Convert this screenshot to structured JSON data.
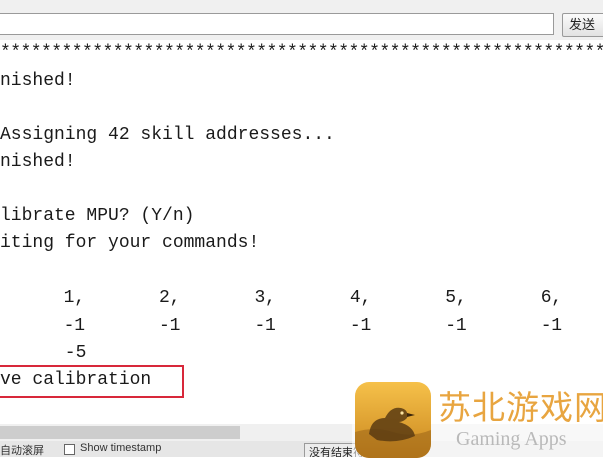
{
  "toolbar": {
    "send_label": "发送",
    "input_value": ""
  },
  "console": {
    "lines": [
      "************************************************************",
      "nished!",
      "",
      "Assigning 42 skill addresses...",
      "nished!",
      "",
      "librate MPU? (Y/n)",
      "iting for your commands!",
      "",
      "      1,       2,       3,       4,       5,       6,",
      "      -1       -1       -1       -1       -1       -1",
      "      -5",
      "ve calibration"
    ]
  },
  "statusbar": {
    "autoscroll_label": "自动滚屏",
    "show_timestamp_label": "Show timestamp",
    "line_ending_label": "没有结束符"
  },
  "watermark": {
    "title": "苏北游戏网",
    "subtitle": "Gaming Apps"
  },
  "colors": {
    "highlight_border": "#d8283a",
    "watermark_title": "#e8a540",
    "watermark_subtitle": "#b9b9b9"
  }
}
